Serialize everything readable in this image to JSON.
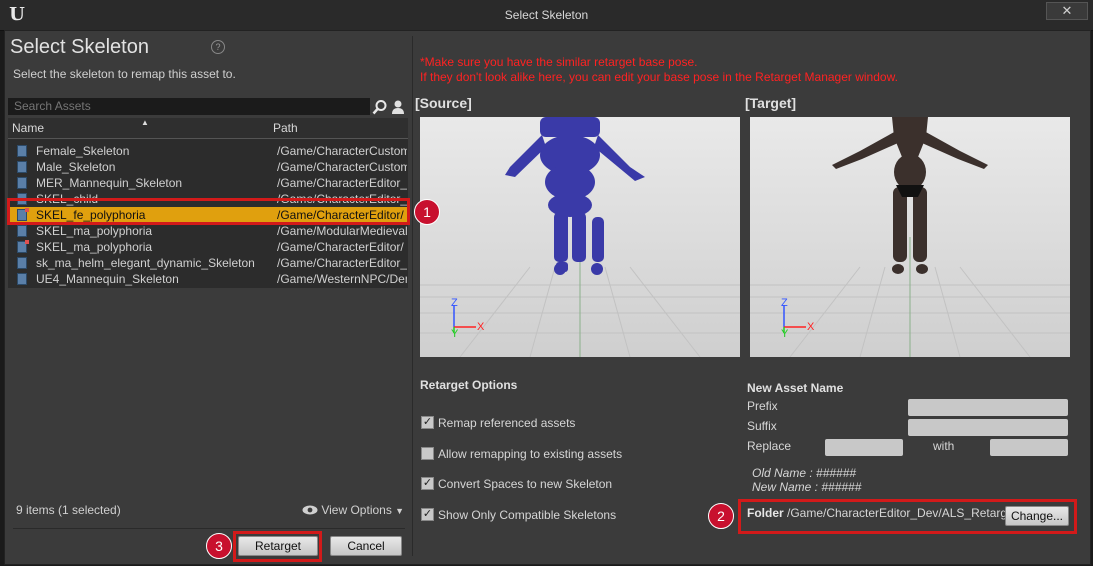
{
  "window": {
    "title": "Select Skeleton",
    "close_glyph": "✕"
  },
  "header": {
    "title": "Select Skeleton",
    "subtitle": "Select the skeleton to remap this asset to.",
    "help_glyph": "?"
  },
  "search": {
    "placeholder": "Search Assets"
  },
  "table": {
    "columns": [
      "Name",
      "Path"
    ],
    "rows": [
      {
        "name": "Female_Skeleton",
        "path": "/Game/CharacterCustomi",
        "icon": "skeleton-asset-icon",
        "selected": false
      },
      {
        "name": "Male_Skeleton",
        "path": "/Game/CharacterCustomi",
        "icon": "skeleton-asset-icon",
        "selected": false
      },
      {
        "name": "MER_Mannequin_Skeleton",
        "path": "/Game/CharacterEditor_",
        "icon": "skeleton-asset-icon",
        "selected": false
      },
      {
        "name": "SKEL_child",
        "path": "/Game/CharacterEditor_",
        "icon": "skeleton-asset-icon",
        "selected": false
      },
      {
        "name": "SKEL_fe_polyphoria",
        "path": "/Game/CharacterEditor/",
        "icon": "skeleton-asset-modified-icon",
        "selected": true
      },
      {
        "name": "SKEL_ma_polyphoria",
        "path": "/Game/ModularMedieval",
        "icon": "skeleton-asset-icon",
        "selected": false
      },
      {
        "name": "SKEL_ma_polyphoria",
        "path": "/Game/CharacterEditor/",
        "icon": "skeleton-asset-modified-icon",
        "selected": false
      },
      {
        "name": "sk_ma_helm_elegant_dynamic_Skeleton",
        "path": "/Game/CharacterEditor_",
        "icon": "skeleton-asset-icon",
        "selected": false
      },
      {
        "name": "UE4_Mannequin_Skeleton",
        "path": "/Game/WesternNPC/Dem",
        "icon": "skeleton-asset-icon",
        "selected": false
      }
    ]
  },
  "footer": {
    "status": "9 items (1 selected)",
    "view_options": "View Options",
    "retarget_label": "Retarget",
    "cancel_label": "Cancel"
  },
  "warning": {
    "line1": "*Make sure you have the similar retarget base pose.",
    "line2": "If they don't look alike here, you can edit your base pose in the Retarget Manager window."
  },
  "viewports": {
    "source_title": "[Source]",
    "target_title": "[Target]",
    "axis_x": "X",
    "axis_y": "Y",
    "axis_z": "Z"
  },
  "retarget_options": {
    "title": "Retarget Options",
    "options": [
      {
        "label": "Remap referenced assets",
        "checked": true
      },
      {
        "label": "Allow remapping to existing assets",
        "checked": false
      },
      {
        "label": "Convert Spaces to new Skeleton",
        "checked": true
      },
      {
        "label": "Show Only Compatible Skeletons",
        "checked": true
      }
    ]
  },
  "new_asset_name": {
    "title": "New Asset Name",
    "prefix_label": "Prefix",
    "prefix_value": "",
    "suffix_label": "Suffix",
    "suffix_value": "",
    "replace_label": "Replace",
    "replace_value": "",
    "with_label": "with",
    "with_value": "",
    "old_name": "Old Name : ######",
    "new_name": "New Name : ######"
  },
  "folder": {
    "label": "Folder",
    "path": "/Game/CharacterEditor_Dev/ALS_Retarg",
    "change_label": "Change..."
  },
  "callouts": [
    "1",
    "2",
    "3"
  ],
  "colors": {
    "selection": "#e0a00e",
    "highlight": "#d21a1a",
    "badge": "#c8102e",
    "warning": "#ff2222",
    "source_figure": "#3a3aa8",
    "target_figure": "#3b302c"
  }
}
